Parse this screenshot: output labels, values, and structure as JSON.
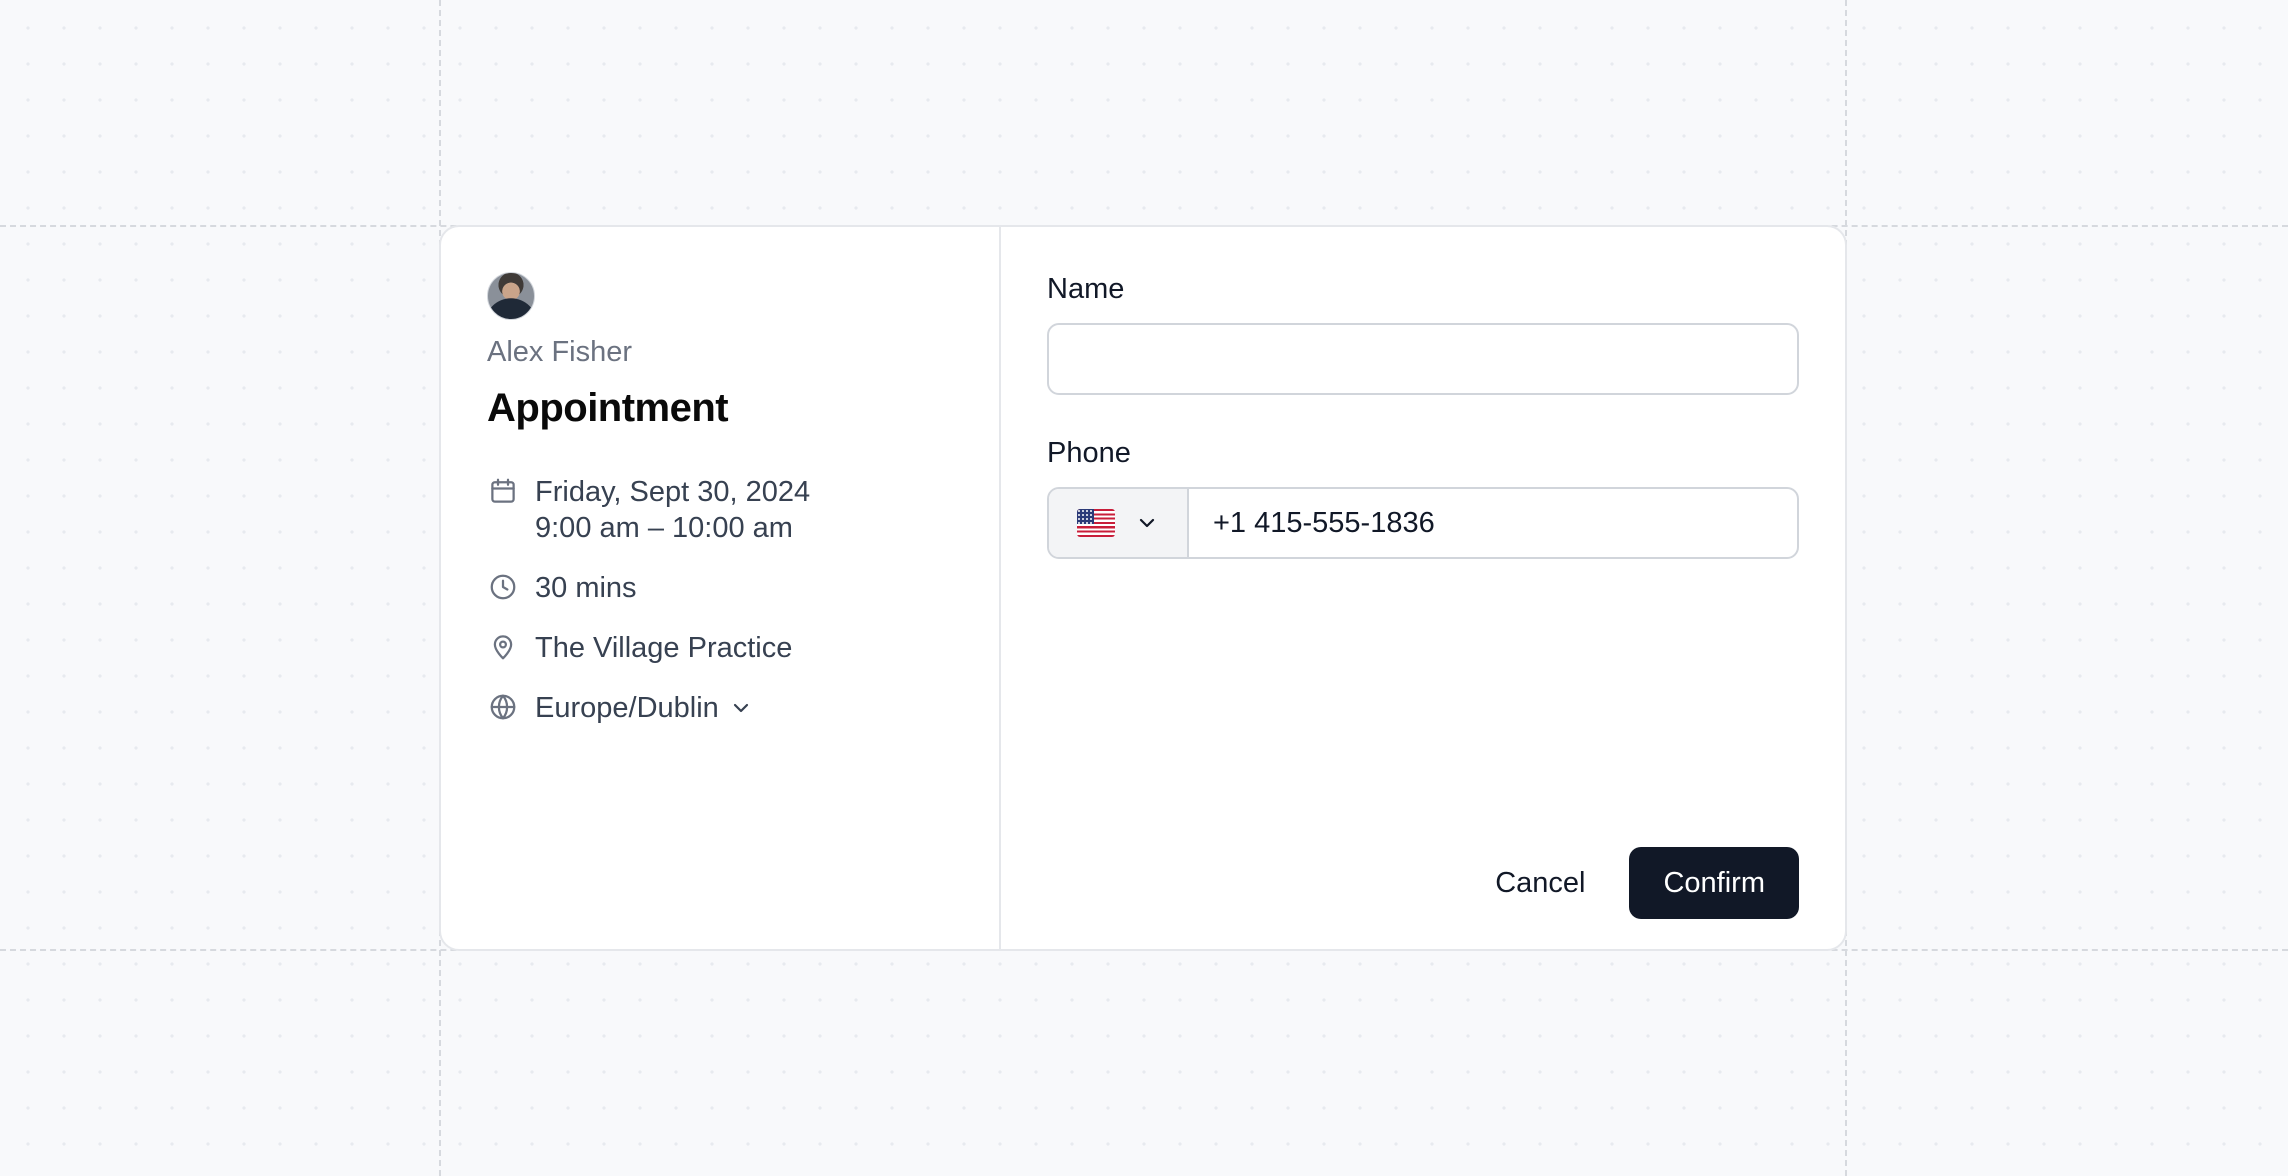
{
  "host": {
    "name": "Alex Fisher"
  },
  "event": {
    "title": "Appointment",
    "date": "Friday, Sept 30, 2024",
    "time": "9:00 am – 10:00 am",
    "duration": "30 mins",
    "location": "The Village Practice",
    "timezone": "Europe/Dublin"
  },
  "form": {
    "name_label": "Name",
    "name_value": "",
    "phone_label": "Phone",
    "phone_country": "US",
    "phone_value": "+1 415-555-1836"
  },
  "actions": {
    "cancel_label": "Cancel",
    "confirm_label": "Confirm"
  },
  "colors": {
    "primary_button": "#111827",
    "border": "#d1d5db",
    "background": "#f8f9fb"
  },
  "icons": {
    "date": "calendar-icon",
    "duration": "clock-icon",
    "location": "map-pin-icon",
    "timezone": "globe-icon"
  }
}
